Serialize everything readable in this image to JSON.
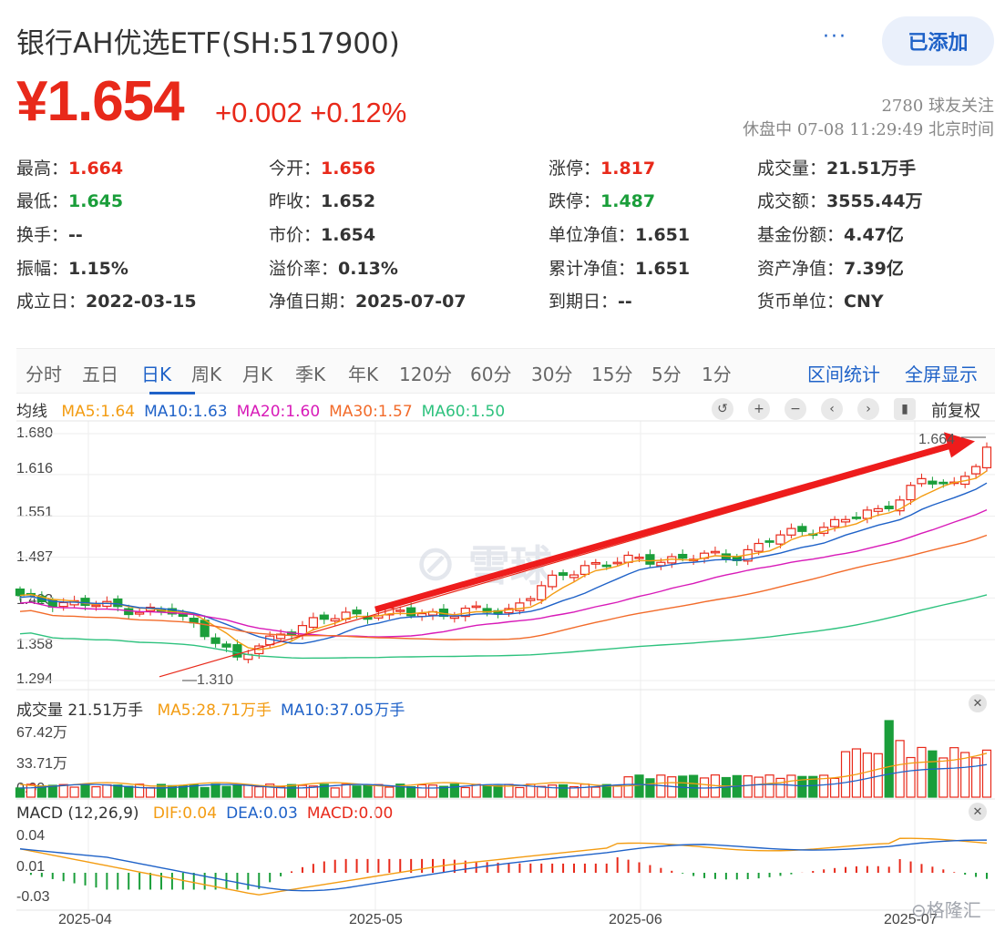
{
  "header": {
    "title": "银行AH优选ETF(SH:517900)",
    "more_label": "···",
    "added_label": "已添加",
    "price": "¥1.654",
    "change": "+0.002 +0.12%",
    "followers": "2780 球友关注",
    "status": "休盘中 07-08 11:29:49 北京时间"
  },
  "stats": [
    {
      "label": "最高：",
      "value": "1.664",
      "color": "red"
    },
    {
      "label": "今开：",
      "value": "1.656",
      "color": "red"
    },
    {
      "label": "涨停：",
      "value": "1.817",
      "color": "red"
    },
    {
      "label": "成交量：",
      "value": "21.51万手",
      "color": ""
    },
    {
      "label": "最低：",
      "value": "1.645",
      "color": "green"
    },
    {
      "label": "昨收：",
      "value": "1.652",
      "color": ""
    },
    {
      "label": "跌停：",
      "value": "1.487",
      "color": "green"
    },
    {
      "label": "成交额：",
      "value": "3555.44万",
      "color": ""
    },
    {
      "label": "换手：",
      "value": "--",
      "color": ""
    },
    {
      "label": "市价：",
      "value": "1.654",
      "color": ""
    },
    {
      "label": "单位净值：",
      "value": "1.651",
      "color": ""
    },
    {
      "label": "基金份额：",
      "value": "4.47亿",
      "color": ""
    },
    {
      "label": "振幅：",
      "value": "1.15%",
      "color": ""
    },
    {
      "label": "溢价率：",
      "value": "0.13%",
      "color": ""
    },
    {
      "label": "累计净值：",
      "value": "1.651",
      "color": ""
    },
    {
      "label": "资产净值：",
      "value": "7.39亿",
      "color": ""
    },
    {
      "label": "成立日：",
      "value": "2022-03-15",
      "color": ""
    },
    {
      "label": "净值日期：",
      "value": "2025-07-07",
      "color": ""
    },
    {
      "label": "到期日：",
      "value": "--",
      "color": ""
    },
    {
      "label": "货币单位：",
      "value": "CNY",
      "color": ""
    }
  ],
  "tabs": [
    "分时",
    "五日",
    "日K",
    "周K",
    "月K",
    "季K",
    "年K",
    "120分",
    "60分",
    "30分",
    "15分",
    "5分",
    "1分"
  ],
  "active_tab": "日K",
  "tab_actions": [
    "区间统计",
    "全屏显示"
  ],
  "ma_legend": {
    "label": "均线",
    "items": [
      {
        "text": "MA5:1.64",
        "color": "#f39c12"
      },
      {
        "text": "MA10:1.63",
        "color": "#1f62c8"
      },
      {
        "text": "MA20:1.60",
        "color": "#d81ab8"
      },
      {
        "text": "MA30:1.57",
        "color": "#f26b2a"
      },
      {
        "text": "MA60:1.50",
        "color": "#2ec27e"
      }
    ]
  },
  "adjust_label": "前复权",
  "price_axis": [
    "1.680",
    "1.616",
    "1.551",
    "1.487",
    "1.423",
    "1.358",
    "1.294"
  ],
  "high_marker": "1.664",
  "low_marker": "1.310",
  "volume_legend": {
    "label": "成交量 21.51万手",
    "items": [
      {
        "text": "MA5:28.71万手",
        "color": "#f39c12"
      },
      {
        "text": "MA10:37.05万手",
        "color": "#1f62c8"
      }
    ]
  },
  "volume_axis": [
    "67.42万",
    "33.71万",
    "0.00"
  ],
  "macd_legend": {
    "label": "MACD (12,26,9)",
    "items": [
      {
        "text": "DIF:0.04",
        "color": "#f39c12"
      },
      {
        "text": "DEA:0.03",
        "color": "#1f62c8"
      },
      {
        "text": "MACD:0.00",
        "color": "#e8291a"
      }
    ]
  },
  "macd_axis": [
    "0.04",
    "0.01",
    "-0.03"
  ],
  "date_labels": [
    "2025-04",
    "2025-05",
    "2025-06",
    "2025-07"
  ],
  "watermark": "雪球",
  "corner_watermark": "格隆汇",
  "colors": {
    "up": "#e8291a",
    "down": "#1a9e3a",
    "accent": "#1f62c8"
  },
  "chart_data": {
    "type": "candlestick",
    "title": "银行AH优选ETF(SH:517900) 日K",
    "ylim": [
      1.294,
      1.68
    ],
    "y_ticks": [
      1.294,
      1.358,
      1.423,
      1.487,
      1.551,
      1.616,
      1.68
    ],
    "x_ticks": [
      "2025-04",
      "2025-05",
      "2025-06",
      "2025-07"
    ],
    "high": 1.664,
    "low": 1.31,
    "ma_last": {
      "MA5": 1.64,
      "MA10": 1.63,
      "MA20": 1.6,
      "MA30": 1.57,
      "MA60": 1.5
    },
    "volume_last": "21.51万手",
    "volume_axis_max": "67.42万",
    "macd_last": {
      "DIF": 0.04,
      "DEA": 0.03,
      "MACD": 0.0
    }
  }
}
